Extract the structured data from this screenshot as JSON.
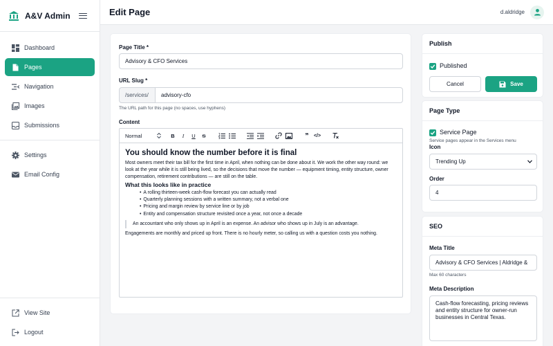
{
  "app": {
    "name": "A&V Admin"
  },
  "sidebar": {
    "items": [
      {
        "label": "Dashboard",
        "icon": "dashboard-icon"
      },
      {
        "label": "Pages",
        "icon": "file-icon",
        "active": true
      },
      {
        "label": "Navigation",
        "icon": "menu-indent-icon"
      },
      {
        "label": "Images",
        "icon": "images-icon"
      },
      {
        "label": "Submissions",
        "icon": "inbox-icon"
      }
    ],
    "settings_items": [
      {
        "label": "Settings",
        "icon": "gear-icon"
      },
      {
        "label": "Email Config",
        "icon": "envelope-icon"
      }
    ],
    "bottom_items": [
      {
        "label": "View Site",
        "icon": "external-link-icon"
      },
      {
        "label": "Logout",
        "icon": "logout-icon"
      }
    ]
  },
  "header": {
    "title": "Edit Page",
    "username": "d.aldridge"
  },
  "form": {
    "page_title_label": "Page Title *",
    "page_title_value": "Advisory & CFO Services",
    "slug_label": "URL Slug *",
    "slug_prefix": "/services/",
    "slug_value": "advisory-cfo",
    "slug_hint": "The URL path for this page (no spaces, use hyphens)",
    "content_label": "Content"
  },
  "editor": {
    "format_select": "Normal",
    "heading": "You should know the number before it is final",
    "paragraph1": "Most owners meet their tax bill for the first time in April, when nothing can be done about it. We work the other way round: we look at the year while it is still being lived, so the decisions that move the number — equipment timing, entity structure, owner compensation, retirement contributions — are still on the table.",
    "subheading": "What this looks like in practice",
    "bullets": [
      "A rolling thirteen-week cash-flow forecast you can actually read",
      "Quarterly planning sessions with a written summary, not a verbal one",
      "Pricing and margin review by service line or by job",
      "Entity and compensation structure revisited once a year, not once a decade"
    ],
    "quote": "An accountant who only shows up in April is an expense. An advisor who shows up in July is an advantage.",
    "paragraph2": "Engagements are monthly and priced up front. There is no hourly meter, so calling us with a question costs you nothing."
  },
  "publish": {
    "title": "Publish",
    "published_label": "Published",
    "cancel_label": "Cancel",
    "save_label": "Save"
  },
  "page_type": {
    "title": "Page Type",
    "service_label": "Service Page",
    "service_hint": "Service pages appear in the Services menu",
    "icon_label": "Icon",
    "icon_value": "Trending Up",
    "order_label": "Order",
    "order_value": "4"
  },
  "seo": {
    "title": "SEO",
    "meta_title_label": "Meta Title",
    "meta_title_value": "Advisory & CFO Services | Aldridge &",
    "meta_title_hint": "Max 60 characters",
    "meta_desc_label": "Meta Description",
    "meta_desc_value": "Cash-flow forecasting, pricing reviews and entity structure for owner-run businesses in Central Texas."
  },
  "colors": {
    "accent": "#1ba383",
    "border": "#d1d5db",
    "background": "#f3f4f6"
  }
}
